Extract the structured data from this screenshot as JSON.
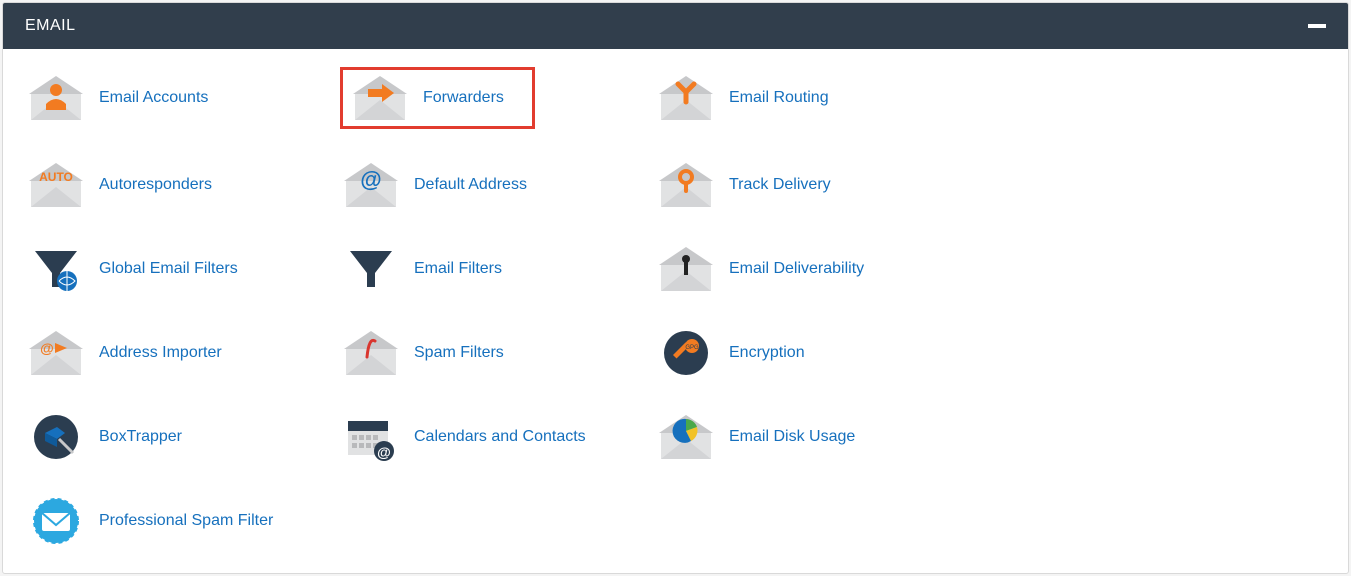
{
  "panel": {
    "title": "EMAIL"
  },
  "items": [
    {
      "id": "email-accounts",
      "label": "Email Accounts",
      "highlight": false
    },
    {
      "id": "forwarders",
      "label": "Forwarders",
      "highlight": true
    },
    {
      "id": "email-routing",
      "label": "Email Routing",
      "highlight": false
    },
    {
      "id": "autoresponders",
      "label": "Autoresponders",
      "highlight": false
    },
    {
      "id": "default-address",
      "label": "Default Address",
      "highlight": false
    },
    {
      "id": "track-delivery",
      "label": "Track Delivery",
      "highlight": false
    },
    {
      "id": "global-email-filters",
      "label": "Global Email Filters",
      "highlight": false
    },
    {
      "id": "email-filters",
      "label": "Email Filters",
      "highlight": false
    },
    {
      "id": "email-deliverability",
      "label": "Email Deliverability",
      "highlight": false
    },
    {
      "id": "address-importer",
      "label": "Address Importer",
      "highlight": false
    },
    {
      "id": "spam-filters",
      "label": "Spam Filters",
      "highlight": false
    },
    {
      "id": "encryption",
      "label": "Encryption",
      "highlight": false
    },
    {
      "id": "boxtrapper",
      "label": "BoxTrapper",
      "highlight": false
    },
    {
      "id": "calendars-contacts",
      "label": "Calendars and Contacts",
      "highlight": false
    },
    {
      "id": "email-disk-usage",
      "label": "Email Disk Usage",
      "highlight": false
    },
    {
      "id": "pro-spam-filter",
      "label": "Professional Spam Filter",
      "highlight": false
    }
  ],
  "colors": {
    "header_bg": "#313e4c",
    "link": "#1670bd",
    "highlight_border": "#e23c2f",
    "orange": "#f27b21",
    "dark": "#2b3d50",
    "gray": "#c7c8ca",
    "lightgray": "#e1e2e3"
  }
}
